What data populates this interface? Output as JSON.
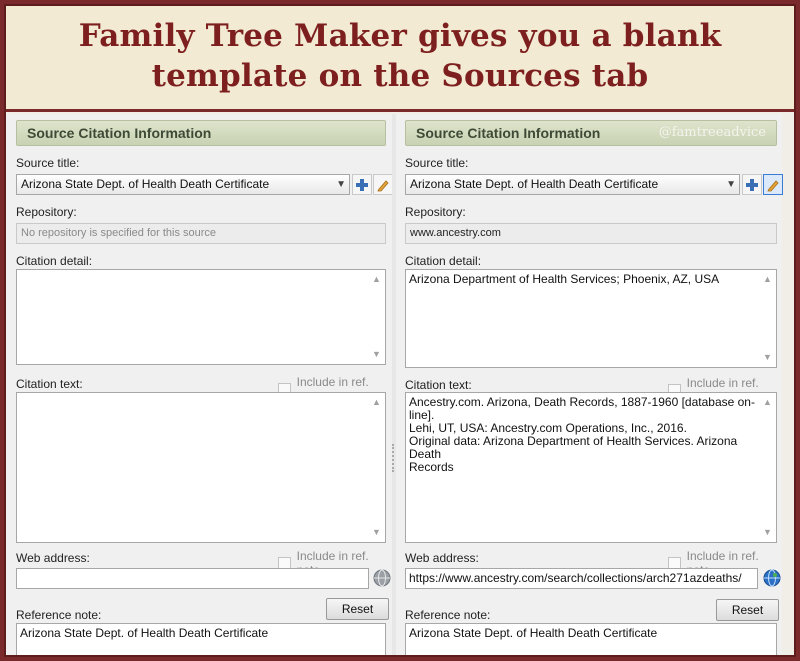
{
  "banner": {
    "line1": "Family Tree Maker gives you a blank",
    "line2": "template on the Sources tab"
  },
  "watermark": "@famtreeadvice",
  "left_panel": {
    "section_title": "Source Citation Information",
    "source_title_label": "Source title:",
    "source_title_value": "Arizona State Dept. of Health Death Certificate",
    "repository_label": "Repository:",
    "repository_value": "No repository is specified for this source",
    "citation_detail_label": "Citation detail:",
    "citation_detail_value": "",
    "citation_text_label": "Citation text:",
    "citation_text_value": "",
    "include_ref_note_label": "Include in ref. note",
    "web_address_label": "Web address:",
    "web_address_value": "",
    "include_ref_note_label_2": "Include in ref. note",
    "reference_note_label": "Reference note:",
    "reset_label": "Reset",
    "reference_note_value": "Arizona State Dept. of Health Death Certificate"
  },
  "right_panel": {
    "section_title": "Source Citation Information",
    "source_title_label": "Source title:",
    "source_title_value": "Arizona State Dept. of Health Death Certificate",
    "repository_label": "Repository:",
    "repository_value": "www.ancestry.com",
    "citation_detail_label": "Citation detail:",
    "citation_detail_value": "Arizona Department of Health Services; Phoenix, AZ, USA",
    "citation_text_label": "Citation text:",
    "citation_text_lines": [
      "Ancestry.com. Arizona, Death Records, 1887-1960 [database on-line].",
      "Lehi, UT, USA: Ancestry.com Operations, Inc., 2016.",
      "Original data: Arizona Department of Health Services. Arizona Death",
      "Records"
    ],
    "include_ref_note_label": "Include in ref. note",
    "web_address_label": "Web address:",
    "web_address_value": "https://www.ancestry.com/search/collections/arch271azdeaths/",
    "include_ref_note_label_2": "Include in ref. note",
    "reference_note_label": "Reference note:",
    "reset_label": "Reset",
    "reference_note_value": "Arizona State Dept. of Health Death Certificate"
  },
  "icons": [
    "add-source-icon",
    "edit-pencil-icon",
    "globe-icon",
    "dropdown-arrow-icon"
  ],
  "colors": {
    "banner_text": "#7d1f1f",
    "border": "#7a2a2a",
    "header_bg": "#c9d2b3"
  }
}
